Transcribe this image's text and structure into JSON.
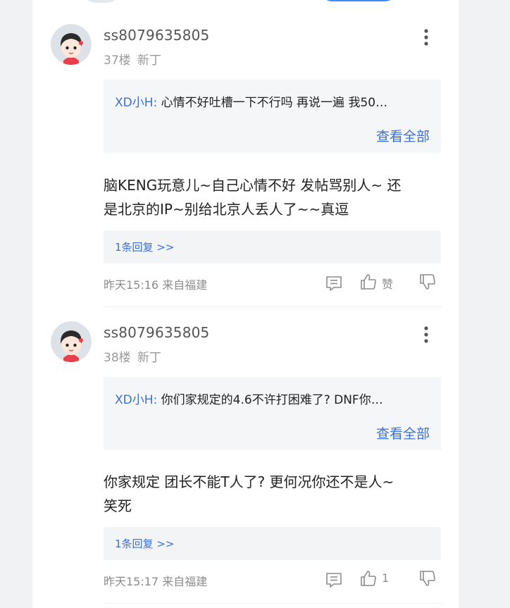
{
  "posts": [
    {
      "username": "ss8079635805",
      "floor": "37楼",
      "level": "新丁",
      "quote_author": "XD小H:",
      "quote_text": "心情不好吐槽一下不行吗  再说一遍  我50…",
      "view_all": "查看全部",
      "content_line1": "脑KENG玩意儿~自己心情不好 发帖骂别人~  还",
      "content_line2": "是北京的IP~别给北京人丢人了~~真逗",
      "reply_label": "1条回复 >>",
      "time_location": "昨天15:16 来自福建",
      "like_label": "赞"
    },
    {
      "username": "ss8079635805",
      "floor": "38楼",
      "level": "新丁",
      "quote_author": "XD小H:",
      "quote_text": "你们家规定的4.6不许打困难了?  DNF你…",
      "view_all": "查看全部",
      "content_line1": "你家规定 团长不能T人了?  更何况你还不是人~",
      "content_line2": "笑死",
      "reply_label": "1条回复 >>",
      "time_location": "昨天15:17 来自福建",
      "like_label": "1"
    }
  ],
  "icons": {
    "more": "more-vertical-icon",
    "comment": "comment-icon",
    "like": "thumbs-up-icon",
    "dislike": "thumbs-down-icon"
  },
  "colors": {
    "link_blue": "#3b70d8",
    "text": "#222222",
    "muted": "#8c8c8c",
    "quote_bg": "#f5f6f8"
  }
}
